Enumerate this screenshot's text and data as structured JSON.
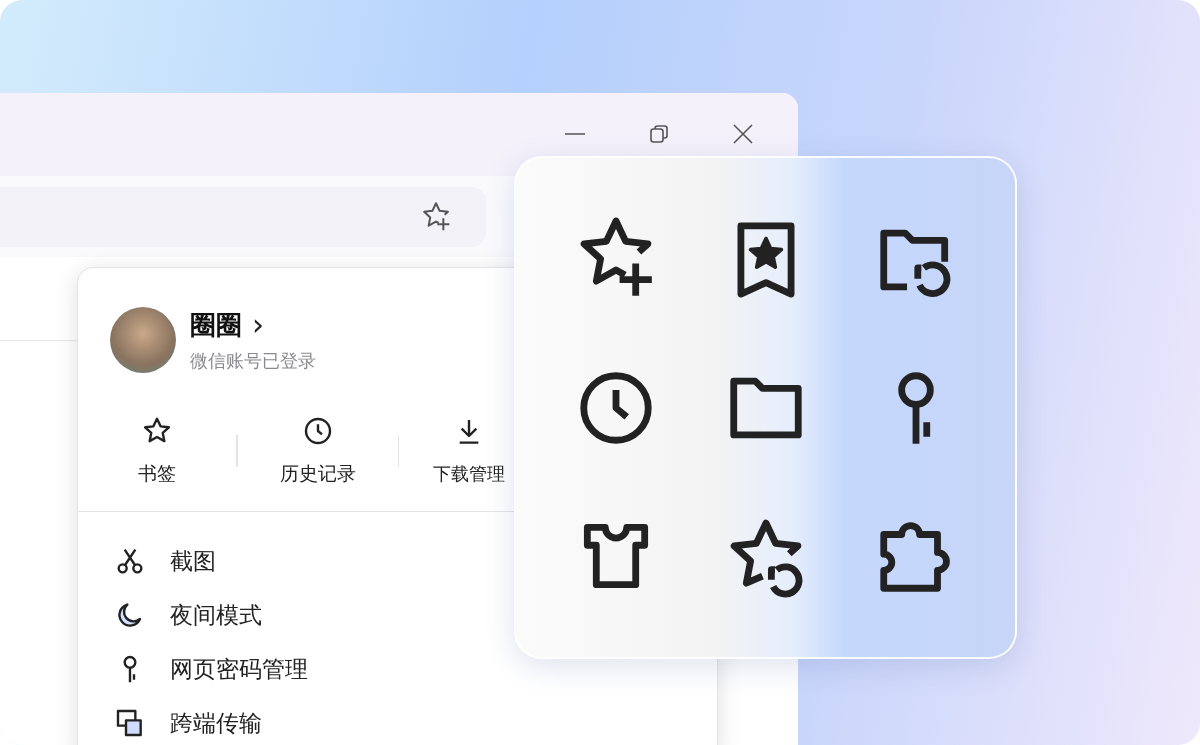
{
  "profile": {
    "name": "圈圈",
    "chevron": "›",
    "status": "微信账号已登录"
  },
  "quick_actions": [
    {
      "kind": "star",
      "label": "书签"
    },
    {
      "kind": "clock",
      "label": "历史记录"
    },
    {
      "kind": "download",
      "label": "下载管理"
    }
  ],
  "menu_items": [
    {
      "kind": "scissors",
      "label": "截图"
    },
    {
      "kind": "moon",
      "label": "夜间模式"
    },
    {
      "kind": "key",
      "label": "网页密码管理"
    },
    {
      "kind": "transfer",
      "label": "跨端传输"
    }
  ],
  "icon_grid": [
    {
      "kind": "star-plus"
    },
    {
      "kind": "bookmark-star"
    },
    {
      "kind": "folder-restore"
    },
    {
      "kind": "clock"
    },
    {
      "kind": "folder"
    },
    {
      "kind": "key"
    },
    {
      "kind": "shirt"
    },
    {
      "kind": "star-restore"
    },
    {
      "kind": "puzzle"
    }
  ]
}
